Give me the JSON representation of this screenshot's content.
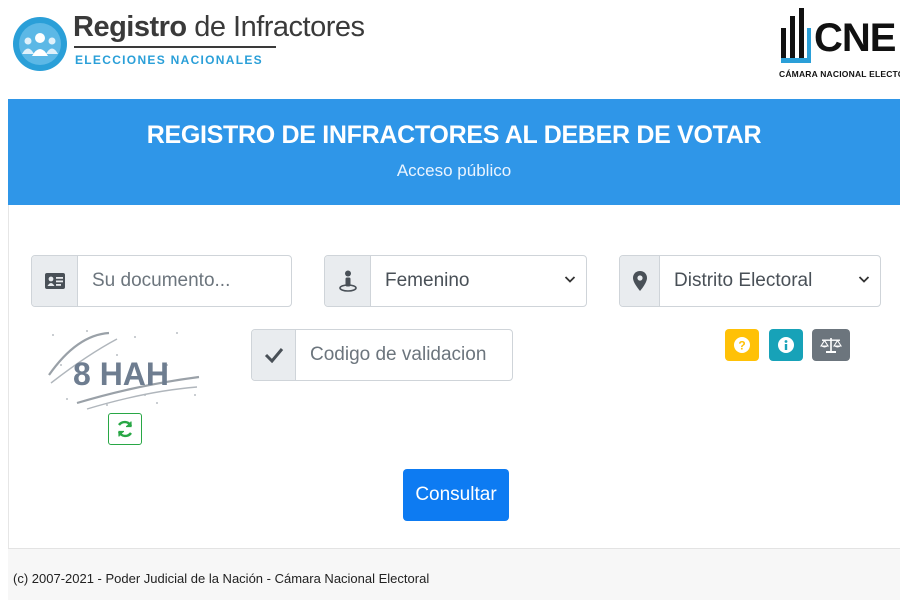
{
  "header": {
    "logo_title_bold": "Registro",
    "logo_title_rest": " de Infractores",
    "logo_subtitle": "ELECCIONES NACIONALES",
    "cne_word": "CNE",
    "cne_subtitle": "CÁMARA NACIONAL ELECTORAL"
  },
  "banner": {
    "title": "REGISTRO DE INFRACTORES AL DEBER DE VOTAR",
    "subtitle": "Acceso público"
  },
  "form": {
    "document": {
      "placeholder": "Su documento...",
      "icon": "id-card-icon"
    },
    "sex": {
      "value": "Femenino",
      "icon": "person-pin-icon"
    },
    "district": {
      "value": "Distrito Electoral",
      "icon": "map-marker-icon"
    },
    "validation": {
      "placeholder": "Codigo de validacion",
      "icon": "check-icon"
    },
    "captcha_text": "8  HAH",
    "submit_label": "Consultar"
  },
  "buttons": {
    "help": {
      "icon": "question-icon",
      "color": "#ffc107"
    },
    "info": {
      "icon": "info-icon",
      "color": "#17a2b8"
    },
    "law": {
      "icon": "balance-scale-icon",
      "color": "#6c757d"
    },
    "refresh": {
      "icon": "refresh-icon",
      "color": "#28a745"
    }
  },
  "footer": {
    "text": "(c) 2007-2021 - Poder Judicial de la Nación - Cámara Nacional Electoral"
  },
  "colors": {
    "banner": "#2f96e8",
    "primary_button": "#0d7bf2",
    "logo_accent": "#2a9fd8"
  }
}
